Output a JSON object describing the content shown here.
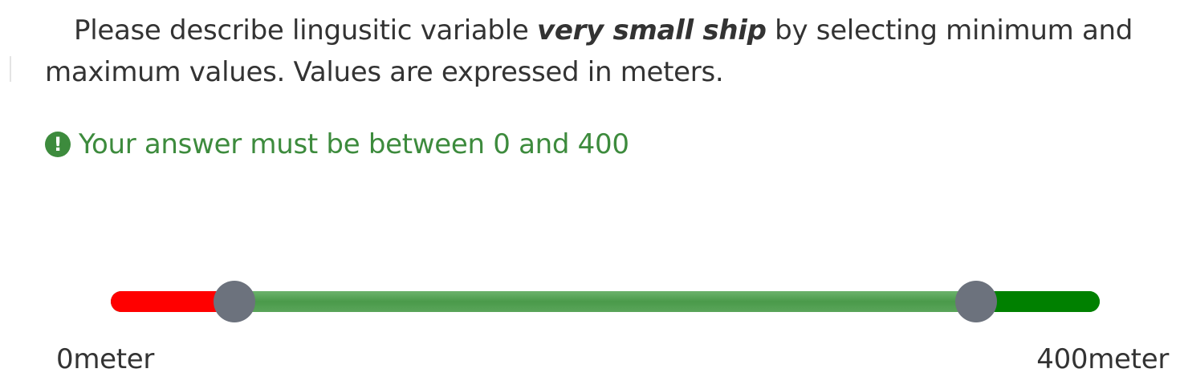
{
  "question": {
    "text_before": "Please describe lingusitic variable ",
    "term": "very small ship",
    "text_after": " by selecting minimum and maximum values. Values are expressed in meters."
  },
  "hint": {
    "icon": "exclamation-circle-icon",
    "text": "Your answer must be between 0 and 400"
  },
  "slider": {
    "min": 0,
    "max": 400,
    "selected_min": 50,
    "selected_max": 350,
    "min_label": "0meter",
    "max_label": "400meter",
    "colors": {
      "below_range": "#ff0000",
      "selected_range": "#4a9a4a",
      "above_range": "#008000",
      "handle": "#6c727d"
    }
  }
}
